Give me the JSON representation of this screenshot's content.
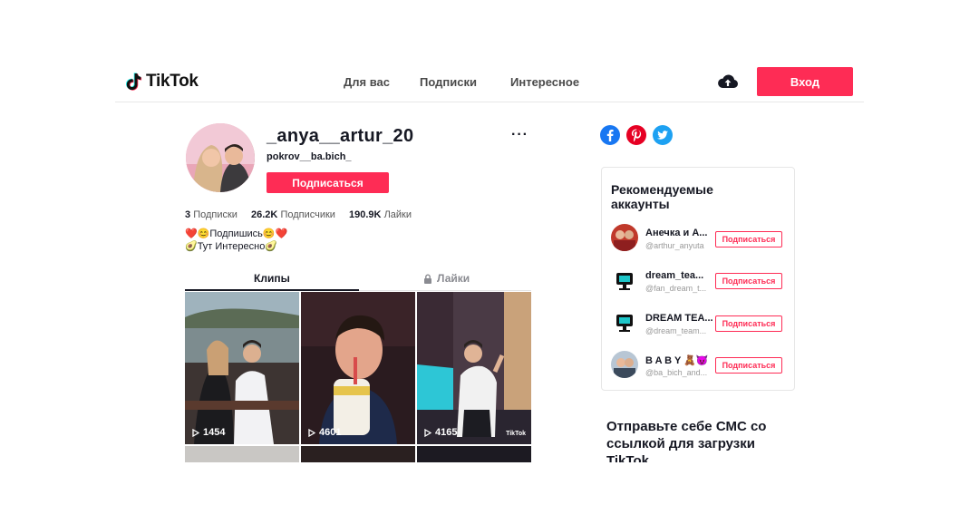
{
  "header": {
    "logo_text": "TikTok",
    "nav": [
      "Для вас",
      "Подписки",
      "Интересное"
    ],
    "login_label": "Вход"
  },
  "profile": {
    "username": "_anya__artur_20",
    "nickname": "pokrov__ba.bich_",
    "follow_label": "Подписаться",
    "more_label": "···",
    "stats": {
      "following_count": "3",
      "following_label": "Подписки",
      "followers_count": "26.2K",
      "followers_label": "Подписчики",
      "likes_count": "190.9K",
      "likes_label": "Лайки"
    },
    "bio": [
      "❤️😊Подпишись😊❤️",
      "🥑Тут Интересно🥑"
    ]
  },
  "tabs": {
    "clips": "Клипы",
    "likes": "Лайки"
  },
  "videos": [
    {
      "views": "1454"
    },
    {
      "views": "4601"
    },
    {
      "views": "4165",
      "watermark": "TikTok"
    }
  ],
  "sidebar": {
    "recommended_title": "Рекомендуемые аккаунты",
    "accounts": [
      {
        "name": "Анечка и А...",
        "handle": "@arthur_anyuta",
        "button": "Подписаться",
        "avatar_icon": "couple-photo"
      },
      {
        "name": "dream_tea...",
        "handle": "@fan_dream_t...",
        "button": "Подписаться",
        "avatar_icon": "tv-logo"
      },
      {
        "name": "DREAM TEA...",
        "handle": "@dream_team...",
        "button": "Подписаться",
        "avatar_icon": "tv-logo"
      },
      {
        "name": "B A B Y 🧸😈",
        "handle": "@ba_bich_and...",
        "button": "Подписаться",
        "avatar_icon": "couple-photo"
      }
    ],
    "sms_title": "Отправьте себе СМС со ссылкой для загрузки TikTok"
  },
  "colors": {
    "accent": "#fe2c55",
    "facebook": "#1877f2",
    "pinterest": "#e60023",
    "twitter": "#1da1f2"
  }
}
